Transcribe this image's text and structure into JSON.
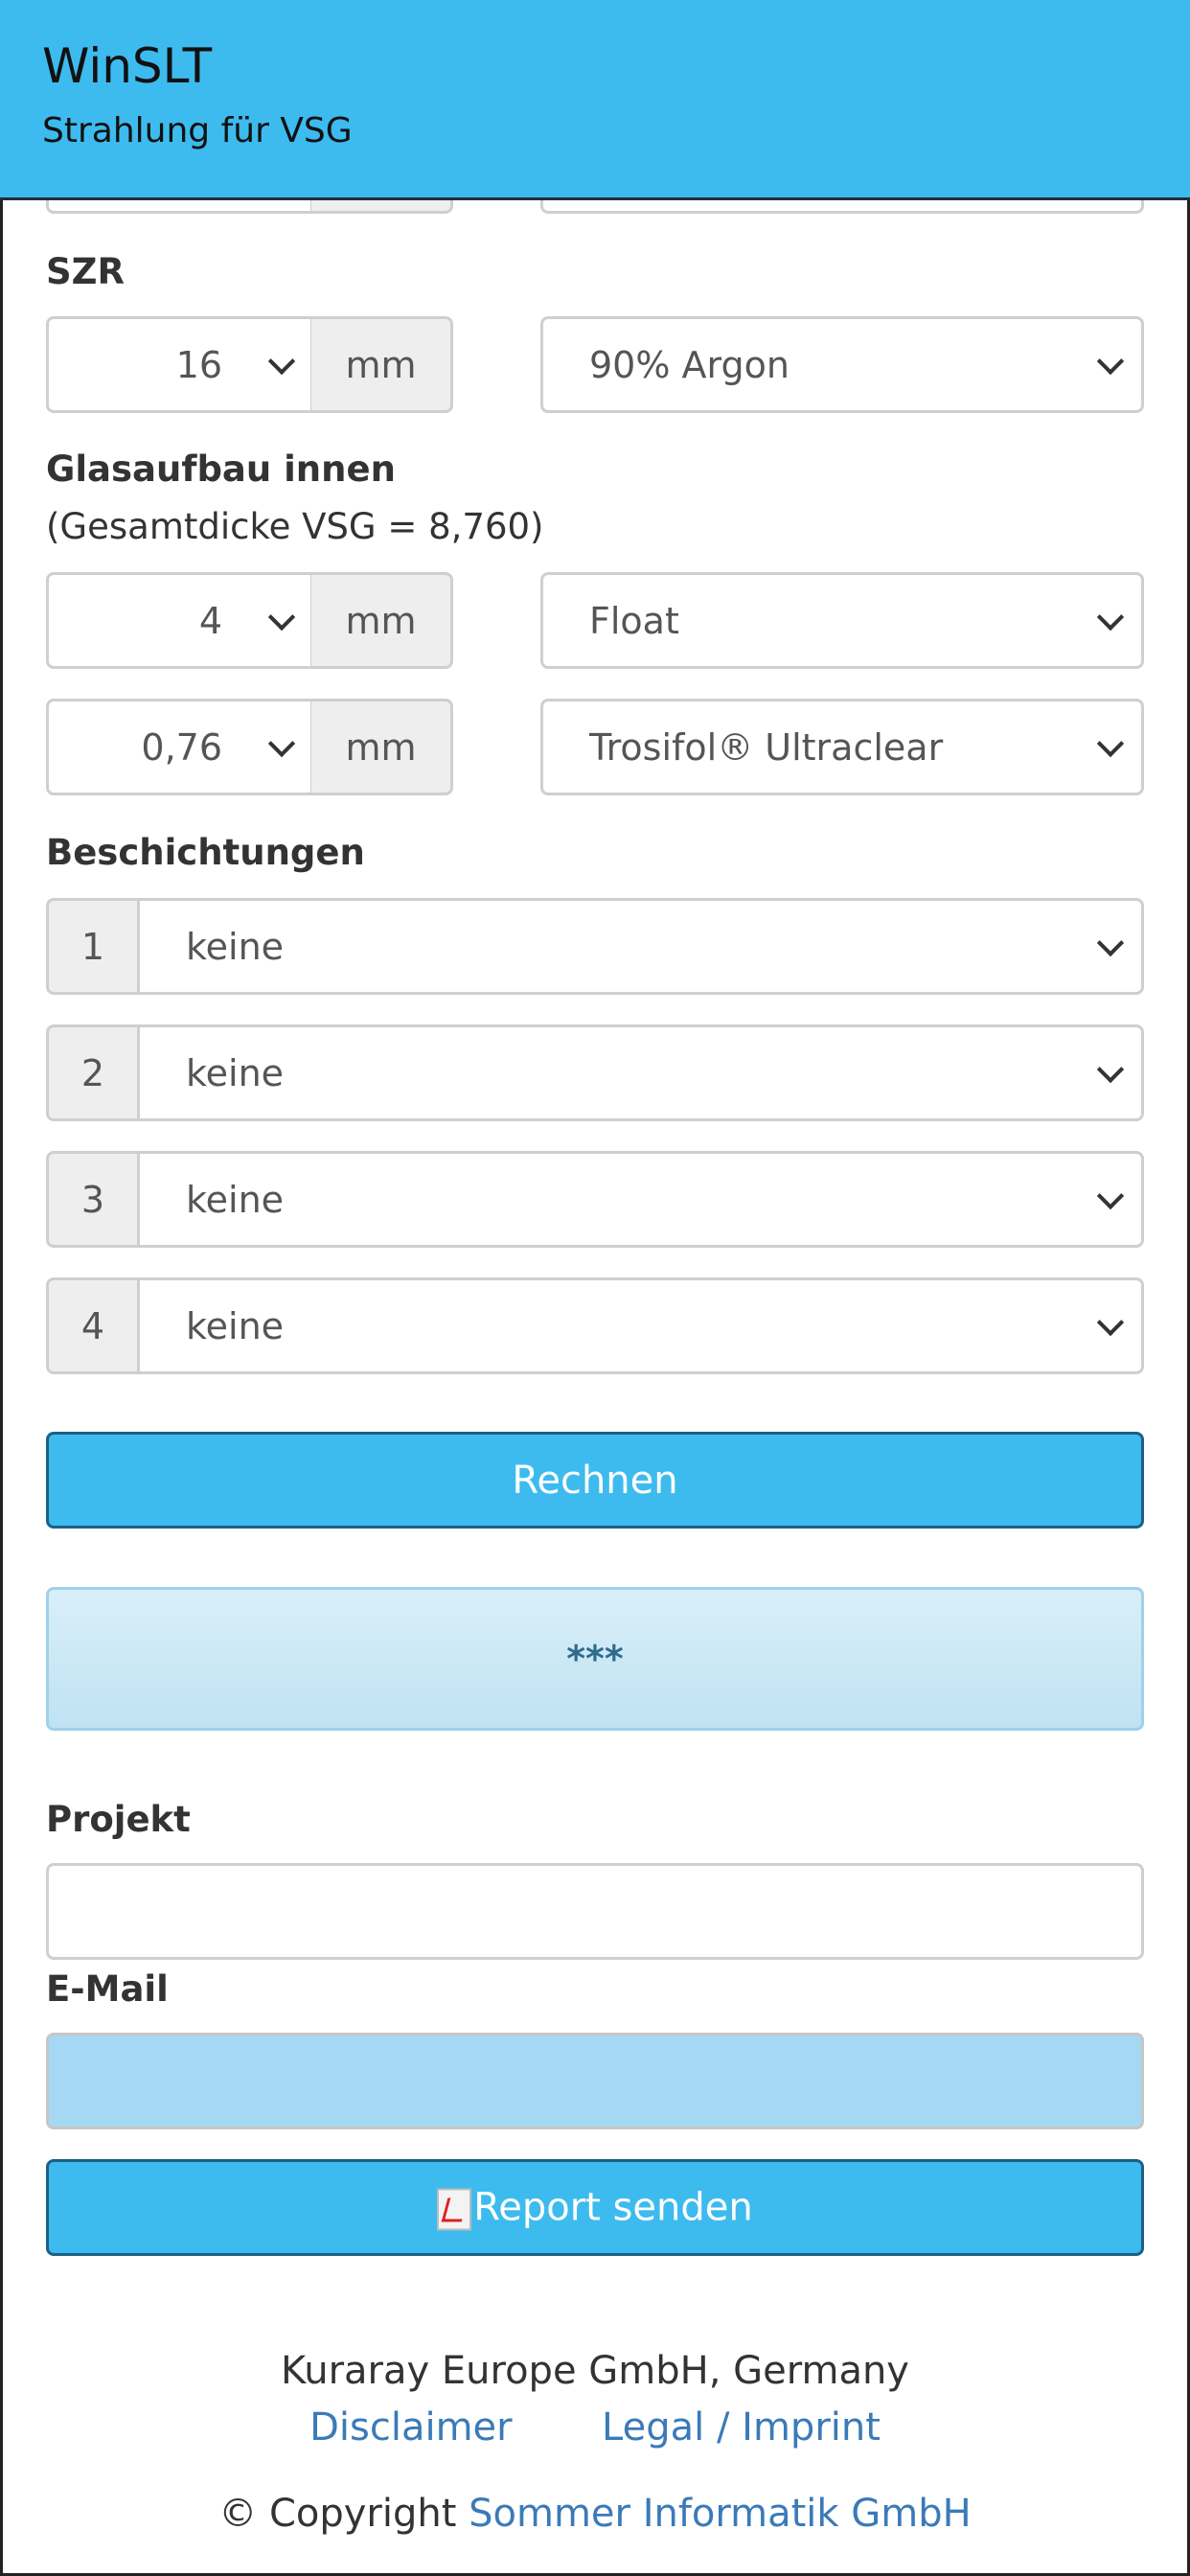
{
  "header": {
    "title": "WinSLT",
    "subtitle": "Strahlung für VSG"
  },
  "szr": {
    "label": "SZR",
    "thickness": "16",
    "unit": "mm",
    "gas": "90% Argon"
  },
  "inner": {
    "label": "Glasaufbau innen",
    "total": "(Gesamtdicke VSG = 8,760)",
    "layers": [
      {
        "thickness": "4",
        "unit": "mm",
        "material": "Float"
      },
      {
        "thickness": "0,76",
        "unit": "mm",
        "material": "Trosifol® Ultraclear"
      }
    ]
  },
  "coatings": {
    "label": "Beschichtungen",
    "items": [
      {
        "number": "1",
        "value": "keine"
      },
      {
        "number": "2",
        "value": "keine"
      },
      {
        "number": "3",
        "value": "keine"
      },
      {
        "number": "4",
        "value": "keine"
      }
    ]
  },
  "calc_button": "Rechnen",
  "result": "***",
  "project": {
    "label": "Projekt",
    "value": ""
  },
  "email": {
    "label": "E-Mail",
    "value": ""
  },
  "report_button": "Report senden",
  "footer": {
    "company": "Kuraray Europe GmbH, Germany",
    "disclaimer": "Disclaimer",
    "legal": "Legal / Imprint",
    "copyright": "© Copyright",
    "developer": "Sommer Informatik GmbH"
  },
  "colors": {
    "accent": "#3dbbee",
    "link": "#3b7ab8",
    "result_bg": "#c8e7f5",
    "email_bg": "#a5d8f3"
  }
}
